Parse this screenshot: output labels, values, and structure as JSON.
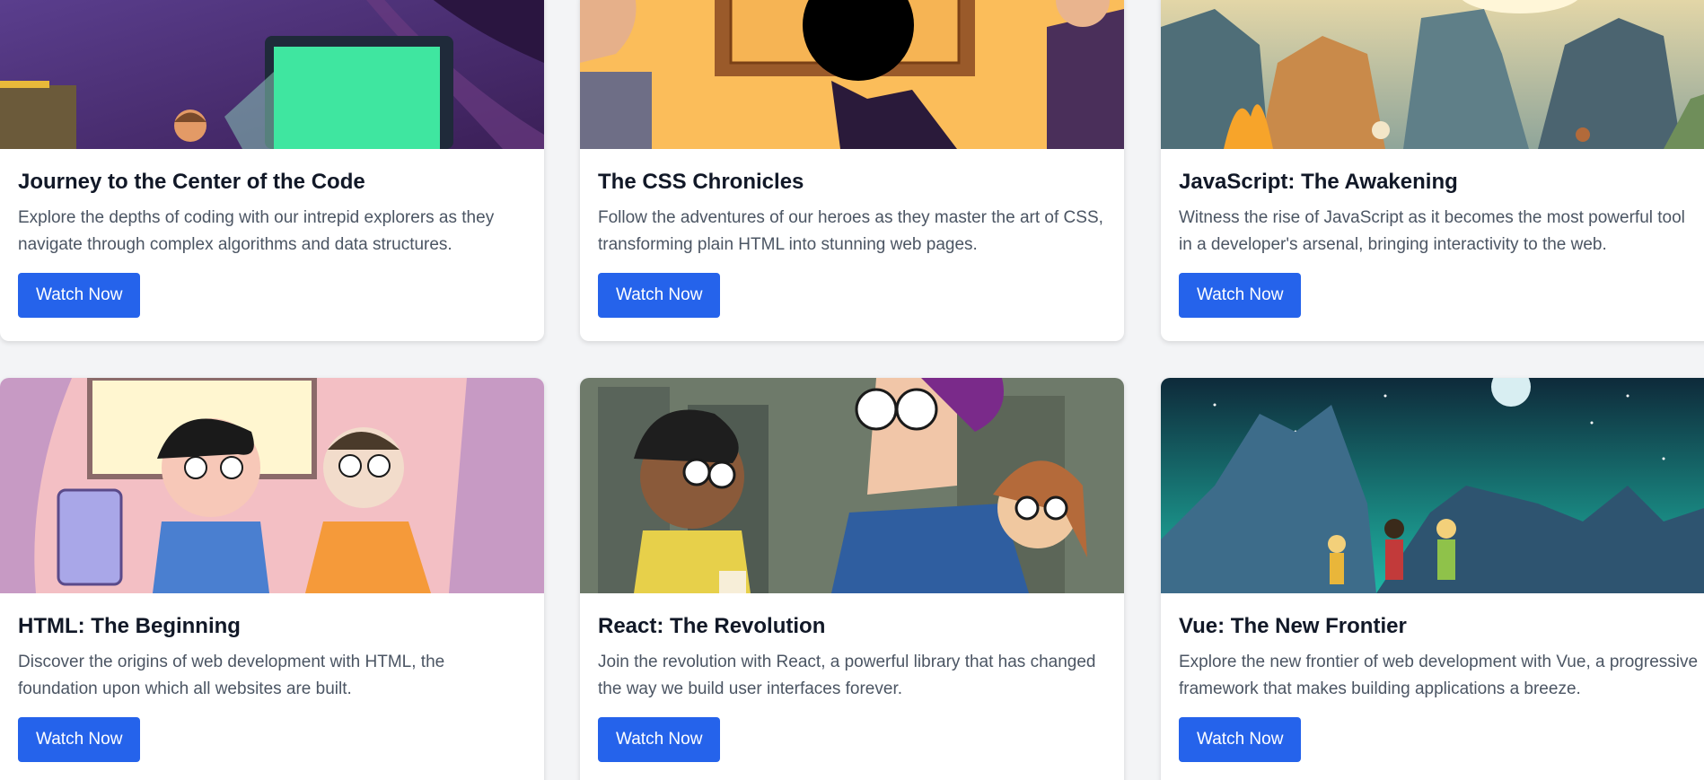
{
  "cards": [
    {
      "title": "Journey to the Center of the Code",
      "description": "Explore the depths of coding with our intrepid explorers as they navigate through complex algorithms and data structures.",
      "button": "Watch Now",
      "image_icon": "computer-screen-illustration"
    },
    {
      "title": "The CSS Chronicles",
      "description": "Follow the adventures of our heroes as they master the art of CSS, transforming plain HTML into stunning web pages.",
      "button": "Watch Now",
      "image_icon": "characters-illustration"
    },
    {
      "title": "JavaScript: The Awakening",
      "description": "Witness the rise of JavaScript as it becomes the most powerful tool in a developer's arsenal, bringing interactivity to the web.",
      "button": "Watch Now",
      "image_icon": "canyon-campfire-illustration"
    },
    {
      "title": "HTML: The Beginning",
      "description": "Discover the origins of web development with HTML, the foundation upon which all websites are built.",
      "button": "Watch Now",
      "image_icon": "two-kids-computer-illustration"
    },
    {
      "title": "React: The Revolution",
      "description": "Join the revolution with React, a powerful library that has changed the way we build user interfaces forever.",
      "button": "Watch Now",
      "image_icon": "city-characters-illustration"
    },
    {
      "title": "Vue: The New Frontier",
      "description": "Explore the new frontier of web development with Vue, a progressive framework that makes building applications a breeze.",
      "button": "Watch Now",
      "image_icon": "night-mountain-illustration"
    }
  ],
  "colors": {
    "page_background": "#f3f4f6",
    "button": "#2563eb",
    "title": "#111827",
    "description": "#4b5563"
  }
}
